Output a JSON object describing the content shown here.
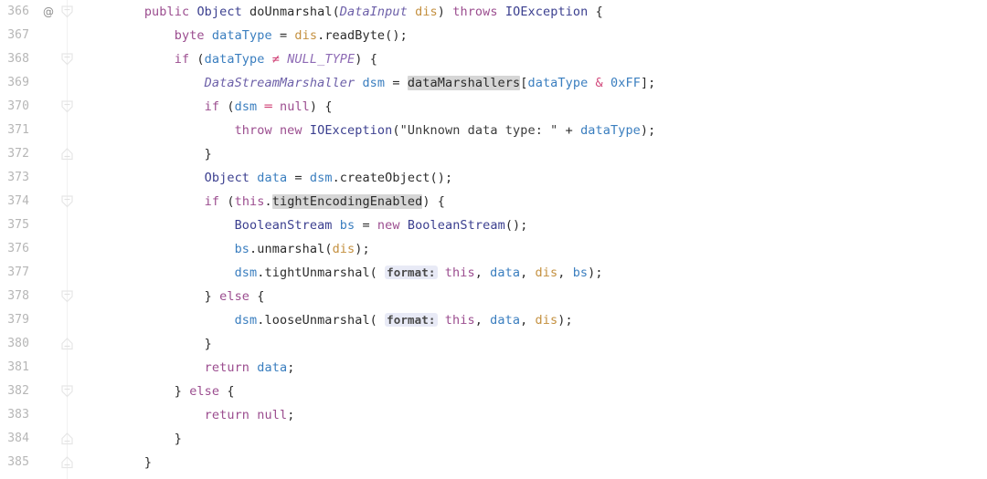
{
  "editor": {
    "language": "java",
    "theme": "IntelliJ Light",
    "first_line_number": 366,
    "colors": {
      "background": "#ffffff",
      "line_number": "#b6b6b6",
      "keyword": "#9b4d8f",
      "type": "#3b3f8f",
      "italic_type": "#6c5fa8",
      "static_field": "#8e6bb5",
      "parameter": "#c4903f",
      "local_variable": "#3a7ebf",
      "operator": "#d1477a",
      "string": "#3b3b3b",
      "identifier_highlight_bg": "#d6d6d6",
      "inlay_hint_bg": "#e8eaf6",
      "fold_rail": "#f1f1f1"
    }
  },
  "lines": [
    {
      "number": "366",
      "annotation": "@",
      "annotation_icon": "at-sign-icon",
      "fold": "collapse",
      "text": "        public Object doUnmarshal(DataInput dis) throws IOException {"
    },
    {
      "number": "367",
      "annotation": "",
      "fold": "none",
      "text": "            byte dataType = dis.readByte();"
    },
    {
      "number": "368",
      "annotation": "",
      "fold": "collapse",
      "text": "            if (dataType ≠ NULL_TYPE) {"
    },
    {
      "number": "369",
      "annotation": "",
      "fold": "none",
      "text": "                DataStreamMarshaller dsm = dataMarshallers[dataType & 0xFF];"
    },
    {
      "number": "370",
      "annotation": "",
      "fold": "collapse",
      "text": "                if (dsm == null) {"
    },
    {
      "number": "371",
      "annotation": "",
      "fold": "none",
      "text": "                    throw new IOException(\"Unknown data type: \" + dataType);"
    },
    {
      "number": "372",
      "annotation": "",
      "fold": "expand",
      "text": "                }"
    },
    {
      "number": "373",
      "annotation": "",
      "fold": "none",
      "text": "                Object data = dsm.createObject();"
    },
    {
      "number": "374",
      "annotation": "",
      "fold": "collapse",
      "text": "                if (this.tightEncodingEnabled) {"
    },
    {
      "number": "375",
      "annotation": "",
      "fold": "none",
      "text": "                    BooleanStream bs = new BooleanStream();"
    },
    {
      "number": "376",
      "annotation": "",
      "fold": "none",
      "text": "                    bs.unmarshal(dis);"
    },
    {
      "number": "377",
      "annotation": "",
      "fold": "none",
      "text": "                    dsm.tightUnmarshal( format: this, data, dis, bs);"
    },
    {
      "number": "378",
      "annotation": "",
      "fold": "collapse",
      "text": "                } else {"
    },
    {
      "number": "379",
      "annotation": "",
      "fold": "none",
      "text": "                    dsm.looseUnmarshal( format: this, data, dis);"
    },
    {
      "number": "380",
      "annotation": "",
      "fold": "expand",
      "text": "                }"
    },
    {
      "number": "381",
      "annotation": "",
      "fold": "none",
      "text": "                return data;"
    },
    {
      "number": "382",
      "annotation": "",
      "fold": "collapse",
      "text": "            } else {"
    },
    {
      "number": "383",
      "annotation": "",
      "fold": "none",
      "text": "                return null;"
    },
    {
      "number": "384",
      "annotation": "",
      "fold": "expand",
      "text": "            }"
    },
    {
      "number": "385",
      "annotation": "",
      "fold": "expand",
      "text": "        }"
    }
  ],
  "highlights": {
    "usage_identifiers": [
      "dataMarshallers",
      "tightEncodingEnabled"
    ],
    "inlay_hints": [
      "format:"
    ]
  },
  "tokens": {
    "l366": [
      {
        "t": "        ",
        "c": "plain"
      },
      {
        "t": "public",
        "c": "kw"
      },
      {
        "t": " ",
        "c": "plain"
      },
      {
        "t": "Object",
        "c": "type"
      },
      {
        "t": " ",
        "c": "plain"
      },
      {
        "t": "doUnmarshal",
        "c": "meth"
      },
      {
        "t": "(",
        "c": "punct"
      },
      {
        "t": "DataInput",
        "c": "itype"
      },
      {
        "t": " ",
        "c": "plain"
      },
      {
        "t": "dis",
        "c": "param"
      },
      {
        "t": ") ",
        "c": "punct"
      },
      {
        "t": "throws",
        "c": "kw"
      },
      {
        "t": " ",
        "c": "plain"
      },
      {
        "t": "IOException",
        "c": "type"
      },
      {
        "t": " {",
        "c": "punct"
      }
    ],
    "l367": [
      {
        "t": "            ",
        "c": "plain"
      },
      {
        "t": "byte",
        "c": "kw"
      },
      {
        "t": " ",
        "c": "plain"
      },
      {
        "t": "dataType",
        "c": "local"
      },
      {
        "t": " = ",
        "c": "punct"
      },
      {
        "t": "dis",
        "c": "param"
      },
      {
        "t": ".",
        "c": "punct"
      },
      {
        "t": "readByte",
        "c": "meth"
      },
      {
        "t": "();",
        "c": "punct"
      }
    ],
    "l368": [
      {
        "t": "            ",
        "c": "plain"
      },
      {
        "t": "if",
        "c": "kw"
      },
      {
        "t": " (",
        "c": "punct"
      },
      {
        "t": "dataType",
        "c": "local"
      },
      {
        "t": " ",
        "c": "plain"
      },
      {
        "t": "≠",
        "c": "op"
      },
      {
        "t": " ",
        "c": "plain"
      },
      {
        "t": "NULL_TYPE",
        "c": "sfield"
      },
      {
        "t": ") {",
        "c": "punct"
      }
    ],
    "l369": [
      {
        "t": "                ",
        "c": "plain"
      },
      {
        "t": "DataStreamMarshaller",
        "c": "itype"
      },
      {
        "t": " ",
        "c": "plain"
      },
      {
        "t": "dsm",
        "c": "local"
      },
      {
        "t": " = ",
        "c": "punct"
      },
      {
        "t": "dataMarshallers",
        "c": "hl-ident"
      },
      {
        "t": "[",
        "c": "punct"
      },
      {
        "t": "dataType",
        "c": "local"
      },
      {
        "t": " ",
        "c": "plain"
      },
      {
        "t": "&",
        "c": "op"
      },
      {
        "t": " ",
        "c": "plain"
      },
      {
        "t": "0xFF",
        "c": "local"
      },
      {
        "t": "];",
        "c": "punct"
      }
    ],
    "l370": [
      {
        "t": "                ",
        "c": "plain"
      },
      {
        "t": "if",
        "c": "kw"
      },
      {
        "t": " (",
        "c": "punct"
      },
      {
        "t": "dsm",
        "c": "local"
      },
      {
        "t": " ",
        "c": "plain"
      },
      {
        "t": "═",
        "c": "op"
      },
      {
        "t": " ",
        "c": "plain"
      },
      {
        "t": "null",
        "c": "kw"
      },
      {
        "t": ") {",
        "c": "punct"
      }
    ],
    "l371": [
      {
        "t": "                    ",
        "c": "plain"
      },
      {
        "t": "throw",
        "c": "kw"
      },
      {
        "t": " ",
        "c": "plain"
      },
      {
        "t": "new",
        "c": "kw"
      },
      {
        "t": " ",
        "c": "plain"
      },
      {
        "t": "IOException",
        "c": "type"
      },
      {
        "t": "(",
        "c": "punct"
      },
      {
        "t": "\"Unknown data type: \"",
        "c": "str"
      },
      {
        "t": " + ",
        "c": "punct"
      },
      {
        "t": "dataType",
        "c": "local"
      },
      {
        "t": ");",
        "c": "punct"
      }
    ],
    "l372": [
      {
        "t": "                ",
        "c": "plain"
      },
      {
        "t": "}",
        "c": "punct"
      }
    ],
    "l373": [
      {
        "t": "                ",
        "c": "plain"
      },
      {
        "t": "Object",
        "c": "type"
      },
      {
        "t": " ",
        "c": "plain"
      },
      {
        "t": "data",
        "c": "local"
      },
      {
        "t": " = ",
        "c": "punct"
      },
      {
        "t": "dsm",
        "c": "local"
      },
      {
        "t": ".",
        "c": "punct"
      },
      {
        "t": "createObject",
        "c": "meth"
      },
      {
        "t": "();",
        "c": "punct"
      }
    ],
    "l374": [
      {
        "t": "                ",
        "c": "plain"
      },
      {
        "t": "if",
        "c": "kw"
      },
      {
        "t": " (",
        "c": "punct"
      },
      {
        "t": "this",
        "c": "kw"
      },
      {
        "t": ".",
        "c": "punct"
      },
      {
        "t": "tightEncodingEnabled",
        "c": "hl-ident"
      },
      {
        "t": ") {",
        "c": "punct"
      }
    ],
    "l375": [
      {
        "t": "                    ",
        "c": "plain"
      },
      {
        "t": "BooleanStream",
        "c": "type"
      },
      {
        "t": " ",
        "c": "plain"
      },
      {
        "t": "bs",
        "c": "local"
      },
      {
        "t": " = ",
        "c": "punct"
      },
      {
        "t": "new",
        "c": "kw"
      },
      {
        "t": " ",
        "c": "plain"
      },
      {
        "t": "BooleanStream",
        "c": "type"
      },
      {
        "t": "();",
        "c": "punct"
      }
    ],
    "l376": [
      {
        "t": "                    ",
        "c": "plain"
      },
      {
        "t": "bs",
        "c": "local"
      },
      {
        "t": ".",
        "c": "punct"
      },
      {
        "t": "unmarshal",
        "c": "meth"
      },
      {
        "t": "(",
        "c": "punct"
      },
      {
        "t": "dis",
        "c": "param"
      },
      {
        "t": ");",
        "c": "punct"
      }
    ],
    "l377": [
      {
        "t": "                    ",
        "c": "plain"
      },
      {
        "t": "dsm",
        "c": "local"
      },
      {
        "t": ".",
        "c": "punct"
      },
      {
        "t": "tightUnmarshal",
        "c": "meth"
      },
      {
        "t": "( ",
        "c": "punct"
      },
      {
        "t": "format:",
        "c": "hint"
      },
      {
        "t": " ",
        "c": "plain"
      },
      {
        "t": "this",
        "c": "kw"
      },
      {
        "t": ", ",
        "c": "punct"
      },
      {
        "t": "data",
        "c": "local"
      },
      {
        "t": ", ",
        "c": "punct"
      },
      {
        "t": "dis",
        "c": "param"
      },
      {
        "t": ", ",
        "c": "punct"
      },
      {
        "t": "bs",
        "c": "local"
      },
      {
        "t": ");",
        "c": "punct"
      }
    ],
    "l378": [
      {
        "t": "                ",
        "c": "plain"
      },
      {
        "t": "} ",
        "c": "punct"
      },
      {
        "t": "else",
        "c": "kw"
      },
      {
        "t": " {",
        "c": "punct"
      }
    ],
    "l379": [
      {
        "t": "                    ",
        "c": "plain"
      },
      {
        "t": "dsm",
        "c": "local"
      },
      {
        "t": ".",
        "c": "punct"
      },
      {
        "t": "looseUnmarshal",
        "c": "meth"
      },
      {
        "t": "( ",
        "c": "punct"
      },
      {
        "t": "format:",
        "c": "hint"
      },
      {
        "t": " ",
        "c": "plain"
      },
      {
        "t": "this",
        "c": "kw"
      },
      {
        "t": ", ",
        "c": "punct"
      },
      {
        "t": "data",
        "c": "local"
      },
      {
        "t": ", ",
        "c": "punct"
      },
      {
        "t": "dis",
        "c": "param"
      },
      {
        "t": ");",
        "c": "punct"
      }
    ],
    "l380": [
      {
        "t": "                ",
        "c": "plain"
      },
      {
        "t": "}",
        "c": "punct"
      }
    ],
    "l381": [
      {
        "t": "                ",
        "c": "plain"
      },
      {
        "t": "return",
        "c": "kw"
      },
      {
        "t": " ",
        "c": "plain"
      },
      {
        "t": "data",
        "c": "local"
      },
      {
        "t": ";",
        "c": "punct"
      }
    ],
    "l382": [
      {
        "t": "            ",
        "c": "plain"
      },
      {
        "t": "} ",
        "c": "punct"
      },
      {
        "t": "else",
        "c": "kw"
      },
      {
        "t": " {",
        "c": "punct"
      }
    ],
    "l383": [
      {
        "t": "                ",
        "c": "plain"
      },
      {
        "t": "return",
        "c": "kw"
      },
      {
        "t": " ",
        "c": "plain"
      },
      {
        "t": "null",
        "c": "kw"
      },
      {
        "t": ";",
        "c": "punct"
      }
    ],
    "l384": [
      {
        "t": "            ",
        "c": "plain"
      },
      {
        "t": "}",
        "c": "punct"
      }
    ],
    "l385": [
      {
        "t": "        ",
        "c": "plain"
      },
      {
        "t": "}",
        "c": "punct"
      }
    ]
  }
}
